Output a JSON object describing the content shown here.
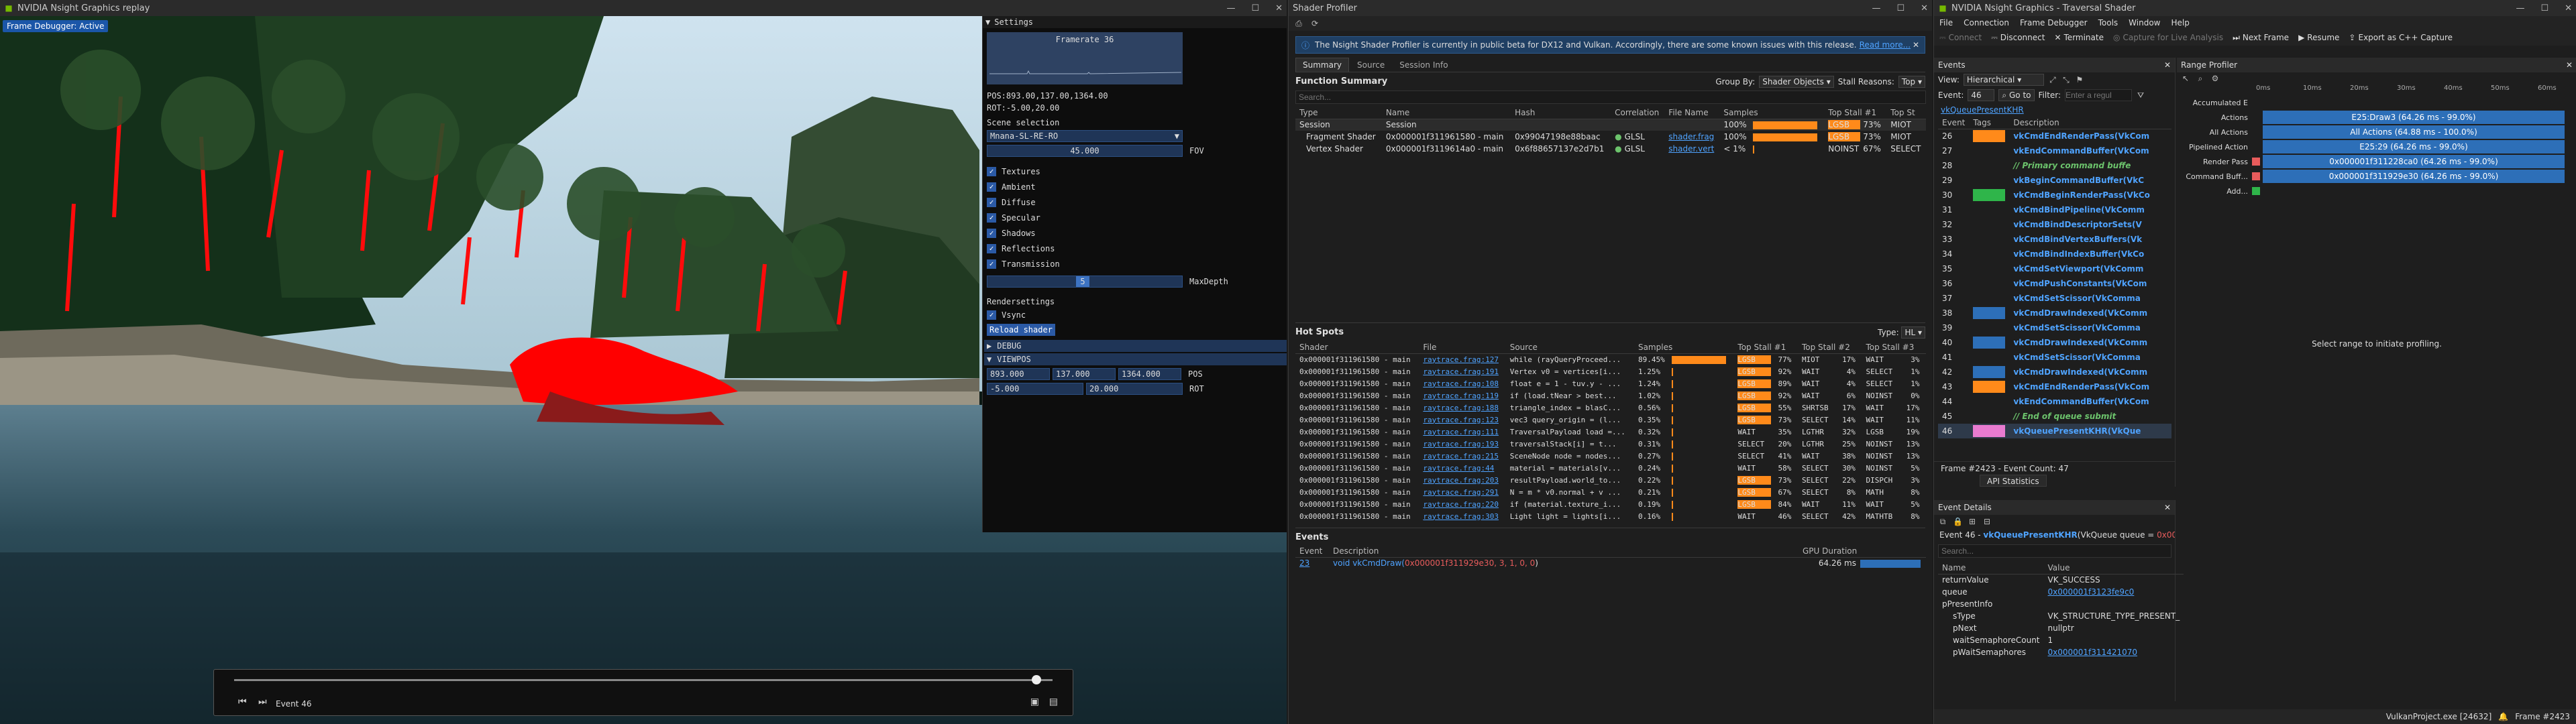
{
  "game": {
    "title": "NVIDIA Nsight Graphics replay",
    "status": "Frame Debugger: Active",
    "settings": {
      "header": "Settings",
      "framerate": "Framerate 36",
      "pos": "POS:893.00,137.00,1364.00",
      "rot": "ROT:-5.00,20.00",
      "scene_label": "Scene selection",
      "scene_value": "Mnana-SL-RE-RO",
      "fov_value": "45.000",
      "fov_label": "FOV",
      "checks": [
        "Textures",
        "Ambient",
        "Diffuse",
        "Specular",
        "Shadows",
        "Reflections",
        "Transmission"
      ],
      "maxdepth_value": "5",
      "maxdepth_label": "MaxDepth",
      "render_label": "Rendersettings",
      "vsync": "Vsync",
      "reload": "Reload shader",
      "debug": "DEBUG",
      "viewpos": "VIEWPOS",
      "pos_vals": [
        "893.000",
        "137.000",
        "1364.000"
      ],
      "pos_label": "POS",
      "rot_vals": [
        "-5.000",
        "20.000"
      ],
      "rot_label": "ROT"
    },
    "playbar": {
      "event": "Event 46",
      "progress": 0.98
    }
  },
  "profiler": {
    "title": "Shader Profiler",
    "banner": "The Nsight Shader Profiler is currently in public beta for DX12 and Vulkan. Accordingly, there are some known issues with this release.",
    "banner_link": "Read more...",
    "tabs": [
      "Summary",
      "Source",
      "Session Info"
    ],
    "fs_title": "Function Summary",
    "group_by_label": "Group By:",
    "group_by_value": "Shader Objects",
    "stall_label": "Stall Reasons:",
    "stall_value": "Top",
    "search": "Search...",
    "fs_headers": [
      "Type",
      "Name",
      "Hash",
      "Correlation",
      "File Name",
      "Samples",
      "Top Stall #1",
      "Top St"
    ],
    "fs_rows": [
      {
        "type": "Session",
        "name": "Session",
        "hash": "",
        "corr": "",
        "file": "",
        "pct": "100%",
        "s1": "LGSB",
        "s1p": "73%",
        "s2": "MIOT"
      },
      {
        "type": "Fragment Shader",
        "name": "0x000001f311961580 - main",
        "hash": "0x99047198e88baac",
        "corr": "GLSL",
        "file": "shader.frag",
        "pct": "100%",
        "s1": "LGSB",
        "s1p": "73%",
        "s2": "MIOT"
      },
      {
        "type": "Vertex Shader",
        "name": "0x000001f3119614a0 - main",
        "hash": "0x6f88657137e2d7b1",
        "corr": "GLSL",
        "file": "shader.vert",
        "pct": "< 1%",
        "s1": "NOINST",
        "s1p": "67%",
        "s2": "SELECT"
      }
    ],
    "hs_title": "Hot Spots",
    "hs_type_label": "Type:",
    "hs_type_value": "HL",
    "hs_headers": [
      "Shader",
      "File",
      "Source",
      "Samples",
      "Top Stall #1",
      "Top Stall #2",
      "Top Stall #3"
    ],
    "hs_rows": [
      {
        "shader": "0x000001f311961580 - main",
        "file": "raytrace.frag:127",
        "src": "while (rayQueryProceed...",
        "pct": "89.45%",
        "s1": "LGSB",
        "s1p": "77%",
        "s2": "MIOT",
        "s2p": "17%",
        "s3": "WAIT",
        "s3p": "3%",
        "w": 0.9
      },
      {
        "shader": "0x000001f311961580 - main",
        "file": "raytrace.frag:191",
        "src": "Vertex v0 = vertices[i...",
        "pct": "1.25%",
        "s1": "LGSB",
        "s1p": "92%",
        "s2": "WAIT",
        "s2p": "4%",
        "s3": "SELECT",
        "s3p": "1%",
        "w": 0.02
      },
      {
        "shader": "0x000001f311961580 - main",
        "file": "raytrace.frag:108",
        "src": "float e = 1 - tuv.y - ...",
        "pct": "1.24%",
        "s1": "LGSB",
        "s1p": "89%",
        "s2": "WAIT",
        "s2p": "4%",
        "s3": "SELECT",
        "s3p": "1%",
        "w": 0.02
      },
      {
        "shader": "0x000001f311961580 - main",
        "file": "raytrace.frag:119",
        "src": "if (load.tNear > best...",
        "pct": "1.02%",
        "s1": "LGSB",
        "s1p": "92%",
        "s2": "WAIT",
        "s2p": "6%",
        "s3": "NOINST",
        "s3p": "0%",
        "w": 0.02
      },
      {
        "shader": "0x000001f311961580 - main",
        "file": "raytrace.frag:188",
        "src": "triangle_index = blasC...",
        "pct": "0.56%",
        "s1": "LGSB",
        "s1p": "55%",
        "s2": "SHRTSB",
        "s2p": "17%",
        "s3": "WAIT",
        "s3p": "17%",
        "w": 0.01
      },
      {
        "shader": "0x000001f311961580 - main",
        "file": "raytrace.frag:123",
        "src": "vec3 query_origin = (l...",
        "pct": "0.35%",
        "s1": "LGSB",
        "s1p": "73%",
        "s2": "SELECT",
        "s2p": "14%",
        "s3": "WAIT",
        "s3p": "11%",
        "w": 0.01
      },
      {
        "shader": "0x000001f311961580 - main",
        "file": "raytrace.frag:111",
        "src": "TraversalPayload load =...",
        "pct": "0.32%",
        "s1": "WAIT",
        "s1p": "35%",
        "s2": "LGTHR",
        "s2p": "32%",
        "s3": "LGSB",
        "s3p": "19%",
        "w": 0.01
      },
      {
        "shader": "0x000001f311961580 - main",
        "file": "raytrace.frag:193",
        "src": "traversalStack[i] = t...",
        "pct": "0.31%",
        "s1": "SELECT",
        "s1p": "20%",
        "s2": "LGTHR",
        "s2p": "25%",
        "s3": "NOINST",
        "s3p": "13%",
        "w": 0.01
      },
      {
        "shader": "0x000001f311961580 - main",
        "file": "raytrace.frag:215",
        "src": "SceneNode node = nodes...",
        "pct": "0.27%",
        "s1": "SELECT",
        "s1p": "41%",
        "s2": "WAIT",
        "s2p": "38%",
        "s3": "NOINST",
        "s3p": "13%",
        "w": 0.01
      },
      {
        "shader": "0x000001f311961580 - main",
        "file": "raytrace.frag:44",
        "src": "material = materials[v...",
        "pct": "0.24%",
        "s1": "WAIT",
        "s1p": "58%",
        "s2": "SELECT",
        "s2p": "30%",
        "s3": "NOINST",
        "s3p": "5%",
        "w": 0.01
      },
      {
        "shader": "0x000001f311961580 - main",
        "file": "raytrace.frag:203",
        "src": "resultPayload.world_to...",
        "pct": "0.22%",
        "s1": "LGSB",
        "s1p": "73%",
        "s2": "SELECT",
        "s2p": "22%",
        "s3": "DISPCH",
        "s3p": "3%",
        "w": 0.01
      },
      {
        "shader": "0x000001f311961580 - main",
        "file": "raytrace.frag:291",
        "src": "N = m * v0.normal + v ...",
        "pct": "0.21%",
        "s1": "LGSB",
        "s1p": "67%",
        "s2": "SELECT",
        "s2p": "8%",
        "s3": "MATH",
        "s3p": "8%",
        "w": 0.01
      },
      {
        "shader": "0x000001f311961580 - main",
        "file": "raytrace.frag:220",
        "src": "if (material.texture_i...",
        "pct": "0.19%",
        "s1": "LGSB",
        "s1p": "84%",
        "s2": "WAIT",
        "s2p": "11%",
        "s3": "WAIT",
        "s3p": "5%",
        "w": 0.01
      },
      {
        "shader": "0x000001f311961580 - main",
        "file": "raytrace.frag:303",
        "src": "Light light = lights[i...",
        "pct": "0.16%",
        "s1": "WAIT",
        "s1p": "46%",
        "s2": "SELECT",
        "s2p": "42%",
        "s3": "MATHTB",
        "s3p": "8%",
        "w": 0.01
      }
    ],
    "ev_title": "Events",
    "ev_headers": [
      "Event",
      "Description",
      "GPU Duration"
    ],
    "ev_row": {
      "event": "23",
      "desc_prefix": "void vkCmdDraw(",
      "desc_args": "0x000001f311929e30, 3, 1, 0, 0",
      "desc_suffix": ")",
      "dur": "64.26 ms"
    }
  },
  "trav": {
    "title": "NVIDIA Nsight Graphics - Traversal Shader",
    "menu": [
      "File",
      "Connection",
      "Frame Debugger",
      "Tools",
      "Window",
      "Help"
    ],
    "toolbar": [
      "Connect",
      "Disconnect",
      "Terminate",
      "Capture for Live Analysis",
      "Next Frame",
      "Resume",
      "Export as C++ Capture"
    ],
    "events_panel": "Events",
    "view_label": "View:",
    "view_value": "Hierarchical",
    "event_label": "Event:",
    "event_value": "46",
    "goto": "Go to",
    "filter_label": "Filter:",
    "filter_placeholder": "Enter a regul",
    "crumb": "vkQueuePresentKHR",
    "ev_headers": [
      "Event",
      "Tags",
      "Description"
    ],
    "events": [
      {
        "n": "26",
        "tag": "#ff8a1a",
        "desc": "vkCmdEndRenderPass(VkCom",
        "kind": "fn"
      },
      {
        "n": "27",
        "tag": "",
        "desc": "vkEndCommandBuffer(VkCom",
        "kind": "fn"
      },
      {
        "n": "28",
        "tag": "",
        "desc": "// Primary command buffe",
        "kind": "cm"
      },
      {
        "n": "29",
        "tag": "",
        "desc": "vkBeginCommandBuffer(VkC",
        "kind": "fn"
      },
      {
        "n": "30",
        "tag": "#2fb54a",
        "desc": "vkCmdBeginRenderPass(VkCo",
        "kind": "fn"
      },
      {
        "n": "31",
        "tag": "",
        "desc": "vkCmdBindPipeline(VkComm",
        "kind": "fn"
      },
      {
        "n": "32",
        "tag": "",
        "desc": "vkCmdBindDescriptorSets(V",
        "kind": "fn"
      },
      {
        "n": "33",
        "tag": "",
        "desc": "vkCmdBindVertexBuffers(Vk",
        "kind": "fn"
      },
      {
        "n": "34",
        "tag": "",
        "desc": "vkCmdBindIndexBuffer(VkCo",
        "kind": "fn"
      },
      {
        "n": "35",
        "tag": "",
        "desc": "vkCmdSetViewport(VkComm",
        "kind": "fn"
      },
      {
        "n": "36",
        "tag": "",
        "desc": "vkCmdPushConstants(VkCom",
        "kind": "fn"
      },
      {
        "n": "37",
        "tag": "",
        "desc": "vkCmdSetScissor(VkComma",
        "kind": "fn"
      },
      {
        "n": "38",
        "tag": "#2d6fb8",
        "desc": "vkCmdDrawIndexed(VkComm",
        "kind": "fn"
      },
      {
        "n": "39",
        "tag": "",
        "desc": "vkCmdSetScissor(VkComma",
        "kind": "fn"
      },
      {
        "n": "40",
        "tag": "#2d6fb8",
        "desc": "vkCmdDrawIndexed(VkComm",
        "kind": "fn"
      },
      {
        "n": "41",
        "tag": "",
        "desc": "vkCmdSetScissor(VkComma",
        "kind": "fn"
      },
      {
        "n": "42",
        "tag": "#2d6fb8",
        "desc": "vkCmdDrawIndexed(VkComm",
        "kind": "fn"
      },
      {
        "n": "43",
        "tag": "#ff8a1a",
        "desc": "vkCmdEndRenderPass(VkCom",
        "kind": "fn"
      },
      {
        "n": "44",
        "tag": "",
        "desc": "vkEndCommandBuffer(VkCom",
        "kind": "fn"
      },
      {
        "n": "45",
        "tag": "",
        "desc": "// End of queue submit",
        "kind": "cm"
      },
      {
        "n": "46",
        "tag": "#e87bd0",
        "desc": "vkQueuePresentKHR(VkQue",
        "kind": "fn"
      }
    ],
    "frame_info": "Frame #2423 - Event Count: 47",
    "api_tab": "API Statistics",
    "range_panel": "Range Profiler",
    "range_ticks": [
      "0ms",
      "10ms",
      "20ms",
      "30ms",
      "40ms",
      "50ms",
      "60ms"
    ],
    "range_rows": [
      {
        "label": "Accumulated E",
        "bar": ""
      },
      {
        "label": "Actions",
        "bar": "E25:Draw3 (64.26 ms - 99.0%)"
      },
      {
        "label": "All Actions",
        "bar": "All Actions (64.88 ms - 100.0%)"
      },
      {
        "label": "Pipelined Action",
        "bar": "E25:29 (64.26 ms - 99.0%)"
      },
      {
        "label": "Render Pass",
        "bar": "0x000001f311228ca0 (64.26 ms - 99.0%)"
      },
      {
        "label": "Command Buff...",
        "bar": "0x000001f311929e30 (64.26 ms - 99.0%)"
      },
      {
        "label": "Add...",
        "bar": ""
      }
    ],
    "range_msg": "Select range to initiate profiling.",
    "details_panel": "Event Details",
    "details_line_prefix": "Event 46 - ",
    "details_fn": "vkQueuePresentKHR",
    "details_rest": "(VkQueue queue = ",
    "details_arg": "0x000001",
    "details_search": "Search...",
    "details_headers": [
      "Name",
      "Value"
    ],
    "details_rows": [
      {
        "name": "returnValue",
        "value": "VK_SUCCESS",
        "link": false,
        "indent": 0
      },
      {
        "name": "queue",
        "value": "0x000001f3123fe9c0",
        "link": true,
        "indent": 0
      },
      {
        "name": "pPresentInfo",
        "value": "",
        "link": false,
        "indent": 0
      },
      {
        "name": "sType",
        "value": "VK_STRUCTURE_TYPE_PRESENT_",
        "link": false,
        "indent": 1
      },
      {
        "name": "pNext",
        "value": "nullptr",
        "link": false,
        "indent": 1
      },
      {
        "name": "waitSemaphoreCount",
        "value": "1",
        "link": false,
        "indent": 1
      },
      {
        "name": "pWaitSemaphores",
        "value": "0x000001f311421070",
        "link": true,
        "indent": 1
      }
    ],
    "statusbar": [
      "VulkanProject.exe [24632]",
      "Frame #2423"
    ]
  }
}
